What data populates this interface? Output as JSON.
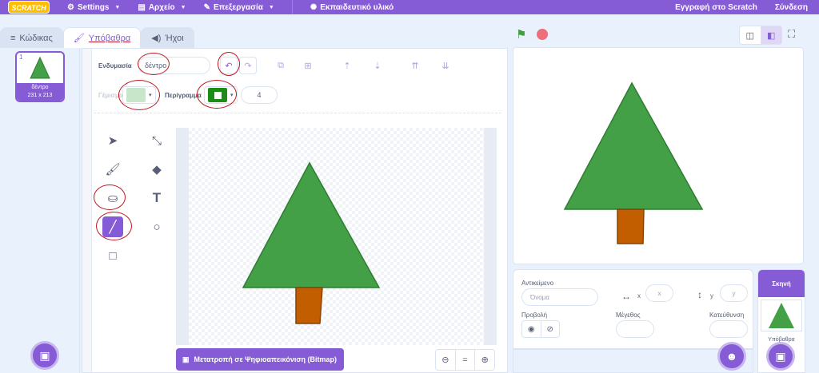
{
  "menubar": {
    "logo": "SCRATCH",
    "settings": "Settings",
    "file": "Αρχείο",
    "edit": "Επεξεργασία",
    "tutorials": "Εκπαιδευτικό υλικό",
    "join": "Εγγραφή στο Scratch",
    "signin": "Σύνδεση"
  },
  "tabs": {
    "code": "Κώδικας",
    "backdrops": "Υπόβαθρα",
    "sounds": "Ήχοι"
  },
  "costume_list": [
    {
      "number": "1",
      "name": "δέντρο",
      "size": "231 x 213"
    }
  ],
  "paint_editor": {
    "backdrop_label": "Ενδυμασία",
    "backdrop_name": "δέντρο",
    "fill_label": "Γέμισμα",
    "outline_label": "Περίγραμμα",
    "outline_width": "4",
    "convert_bitmap": "Μετατροπή σε Ψηφιοαπεικόνιση (Bitmap)",
    "zoom_reset": "="
  },
  "colors": {
    "accent": "#855cd6",
    "tree_green": "#43a047",
    "trunk": "#c25e00",
    "fill_swatch": "#c8e6c9",
    "outline_swatch": "#1b8c16",
    "annotation_red": "#c0171f"
  },
  "sprite_info": {
    "sprite_label": "Αντικείμενο",
    "name_placeholder": "Όνομα",
    "x_label": "x",
    "x_placeholder": "x",
    "y_label": "y",
    "y_placeholder": "y",
    "show_label": "Προβολή",
    "size_label": "Μέγεθος",
    "direction_label": "Κατεύθυνση"
  },
  "stage_panel": {
    "title": "Σκηνή",
    "backdrops_label": "Υπόβαθρα"
  }
}
